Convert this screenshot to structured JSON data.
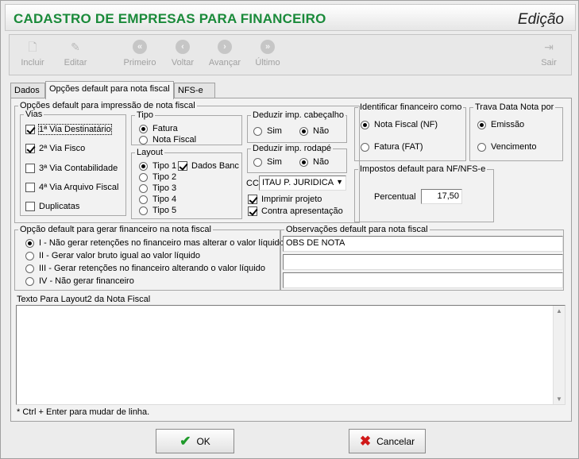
{
  "window": {
    "title": "CADASTRO DE EMPRESAS PARA FINANCEIRO",
    "mode": "Edição"
  },
  "toolbar": {
    "incluir": "Incluir",
    "editar": "Editar",
    "primeiro": "Primeiro",
    "voltar": "Voltar",
    "avancar": "Avançar",
    "ultimo": "Último",
    "sair": "Sair"
  },
  "tabs": [
    "Dados",
    "Opções default para nota fiscal",
    "NFS-e"
  ],
  "impressao": {
    "legend": "Opções default para impressão de nota fiscal",
    "vias": {
      "legend": "Vias",
      "items": [
        {
          "label": "1ª Via Destinatário",
          "checked": true
        },
        {
          "label": "2ª Via Fisco",
          "checked": true
        },
        {
          "label": "3ª Via Contabilidade",
          "checked": false
        },
        {
          "label": "4ª Via Arquivo Fiscal",
          "checked": false
        },
        {
          "label": "Duplicatas",
          "checked": false
        }
      ]
    },
    "tipo": {
      "legend": "Tipo",
      "options": [
        "Fatura",
        "Nota Fiscal"
      ],
      "selected": "Fatura"
    },
    "layout": {
      "legend": "Layout",
      "options": [
        "Tipo 1",
        "Tipo 2",
        "Tipo 3",
        "Tipo 4",
        "Tipo 5"
      ],
      "selected": "Tipo 1",
      "dados_banc": {
        "label": "Dados Banc",
        "checked": true
      }
    },
    "cabecalho": {
      "legend": "Deduzir imp. cabeçalho",
      "options": [
        "Sim",
        "Não"
      ],
      "selected": "Não"
    },
    "rodape": {
      "legend": "Deduzir imp. rodapé",
      "options": [
        "Sim",
        "Não"
      ],
      "selected": "Não"
    },
    "cc": {
      "label": "CC",
      "value": "ITAU P. JURIDICA"
    },
    "imprimir_projeto": {
      "label": "Imprimir projeto",
      "checked": true
    },
    "contra_apresentacao": {
      "label": "Contra apresentação",
      "checked": true
    }
  },
  "identificar": {
    "legend": "Identificar financeiro como",
    "options": [
      "Nota Fiscal (NF)",
      "Fatura (FAT)"
    ],
    "selected": "Nota Fiscal (NF)"
  },
  "trava": {
    "legend": "Trava Data Nota por",
    "options": [
      "Emissão",
      "Vencimento"
    ],
    "selected": "Emissão"
  },
  "impostos": {
    "legend": "Impostos default para NF/NFS-e",
    "label": "Percentual",
    "value": "17,50"
  },
  "gerar": {
    "legend": "Opção default para gerar financeiro na nota fiscal",
    "options": [
      "I - Não gerar retenções no financeiro mas alterar o valor líquido",
      "II - Gerar valor bruto igual ao valor líquido",
      "III - Gerar retenções no financeiro alterando o valor líquido",
      "IV - Não gerar financeiro"
    ],
    "selected": 0
  },
  "observacoes": {
    "legend": "Observações default para nota fiscal",
    "lines": [
      "OBS DE NOTA",
      "",
      ""
    ]
  },
  "texto_layout2": {
    "label": "Texto Para Layout2 da Nota Fiscal",
    "value": "",
    "hint": "* Ctrl + Enter para mudar de linha."
  },
  "buttons": {
    "ok": "OK",
    "cancelar": "Cancelar"
  },
  "colors": {
    "title": "#1a8a3a",
    "ok_icon": "#1e9a2a",
    "cancel_icon": "#d01818"
  }
}
